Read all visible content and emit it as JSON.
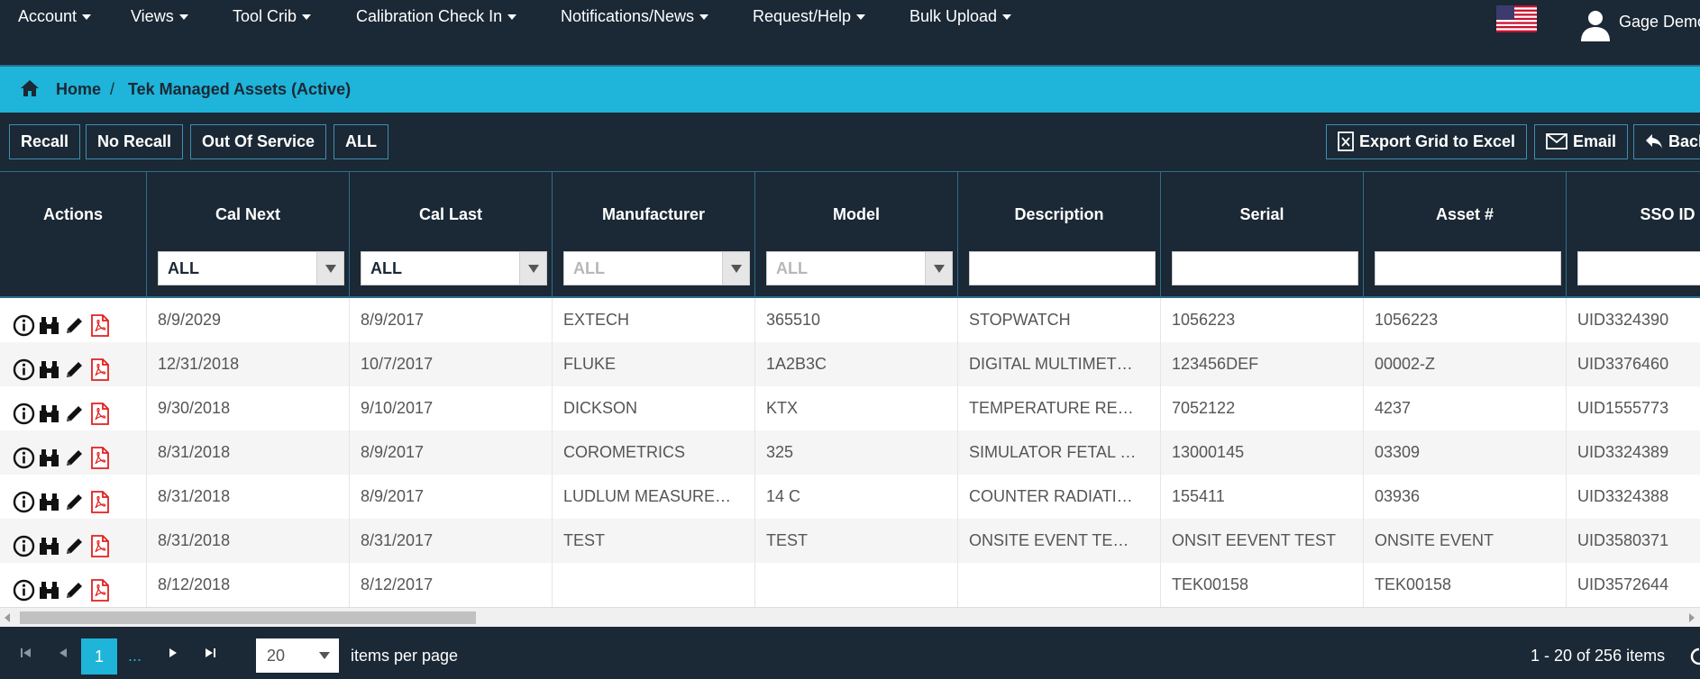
{
  "nav": {
    "items": [
      "Account",
      "Views",
      "Tool Crib",
      "Calibration Check In",
      "Notifications/News",
      "Request/Help",
      "Bulk Upload"
    ],
    "user_name": "Gage Demo"
  },
  "breadcrumb": {
    "home": "Home",
    "separator": "/",
    "current": "Tek Managed Assets (Active)"
  },
  "toolbar": {
    "filters": [
      "Recall",
      "No Recall",
      "Out Of Service",
      "ALL"
    ],
    "export_label": "Export Grid to Excel",
    "email_label": "Email",
    "back_label": "Back"
  },
  "grid": {
    "columns": [
      "Actions",
      "Cal Next",
      "Cal Last",
      "Manufacturer",
      "Model",
      "Description",
      "Serial",
      "Asset #",
      "SSO ID"
    ],
    "filters": {
      "cal_next": "ALL",
      "cal_last": "ALL",
      "manufacturer": "ALL",
      "model": "ALL"
    },
    "rows": [
      [
        "8/9/2029",
        "8/9/2017",
        "EXTECH",
        "365510",
        "STOPWATCH",
        "1056223",
        "1056223",
        "UID3324390"
      ],
      [
        "12/31/2018",
        "10/7/2017",
        "FLUKE",
        "1A2B3C",
        "DIGITAL MULTIMET…",
        "123456DEF",
        "00002-Z",
        "UID3376460"
      ],
      [
        "9/30/2018",
        "9/10/2017",
        "DICKSON",
        "KTX",
        "TEMPERATURE RE…",
        "7052122",
        "4237",
        "UID1555773"
      ],
      [
        "8/31/2018",
        "8/9/2017",
        "COROMETRICS",
        "325",
        "SIMULATOR FETAL …",
        "13000145",
        "03309",
        "UID3324389"
      ],
      [
        "8/31/2018",
        "8/9/2017",
        "LUDLUM MEASURE…",
        "14 C",
        "COUNTER RADIATI…",
        "155411",
        "03936",
        "UID3324388"
      ],
      [
        "8/31/2018",
        "8/31/2017",
        "TEST",
        "TEST",
        "ONSITE EVENT TE…",
        "ONSIT EEVENT TEST",
        "ONSITE EVENT",
        "UID3580371"
      ],
      [
        "8/12/2018",
        "8/12/2017",
        "",
        "",
        "",
        "TEK00158",
        "TEK00158",
        "UID3572644"
      ]
    ]
  },
  "pager": {
    "current_page": "1",
    "more": "...",
    "page_size": "20",
    "page_size_label": "items per page",
    "info": "1 - 20 of 256 items"
  },
  "colors": {
    "navy": "#1b2835",
    "accent": "#1fb4d9",
    "pdf_red": "#e02020"
  },
  "icons": [
    "home-icon",
    "info-icon",
    "binoculars-icon",
    "pencil-icon",
    "pdf-icon",
    "excel-icon",
    "envelope-icon",
    "back-arrow-icon",
    "user-icon",
    "us-flag-icon",
    "refresh-icon"
  ]
}
